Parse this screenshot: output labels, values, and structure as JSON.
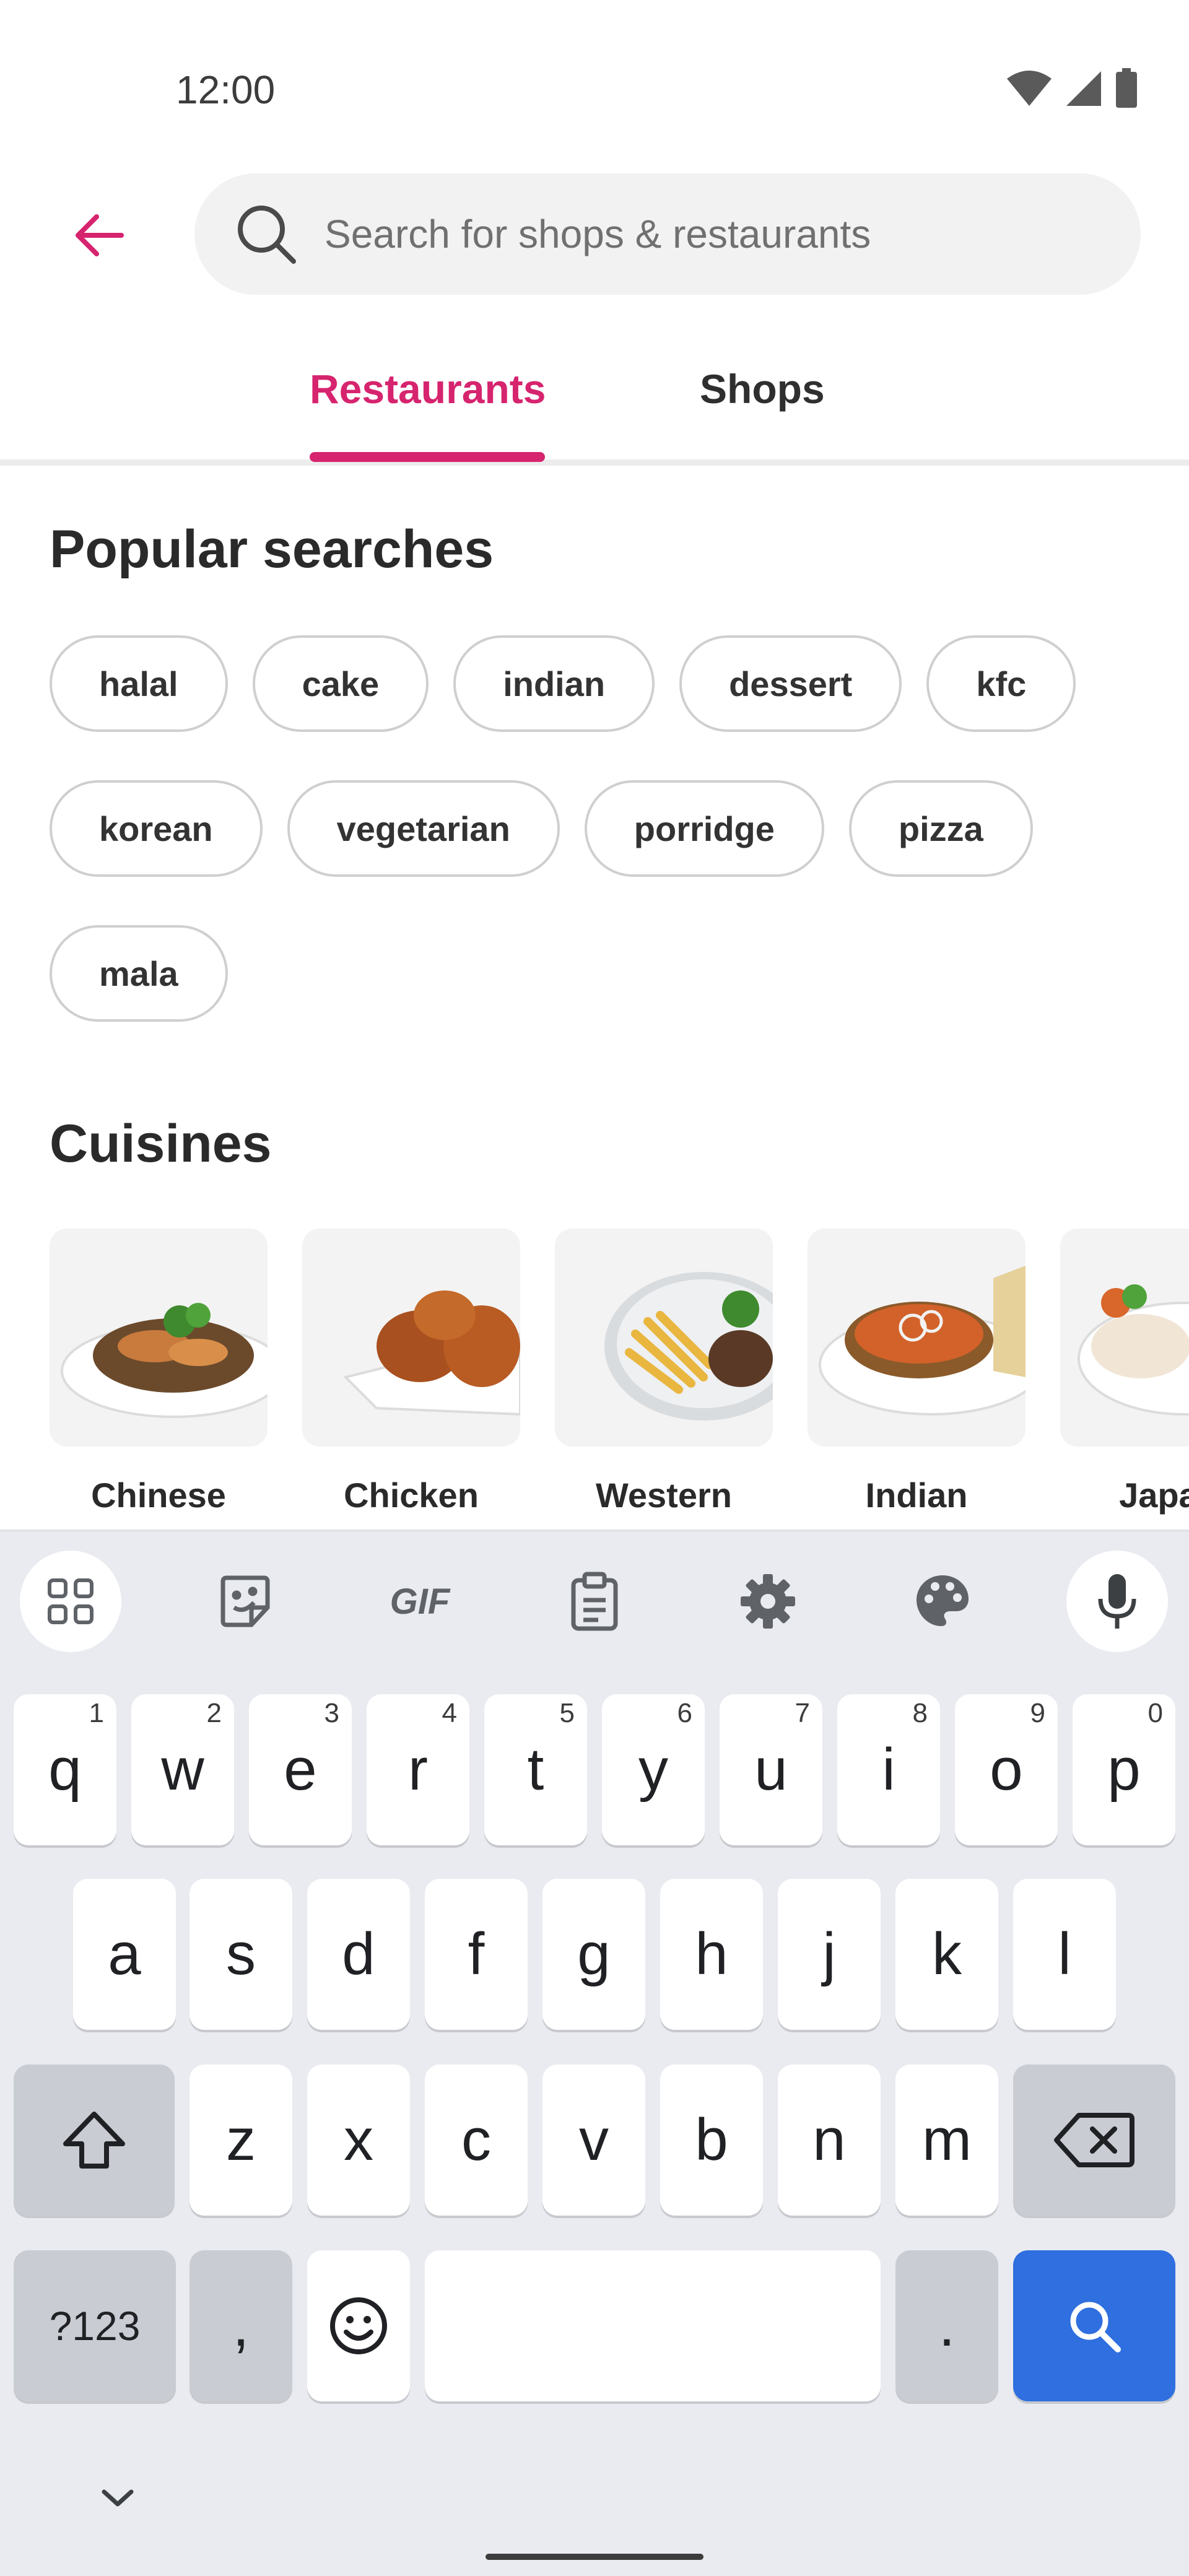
{
  "status_bar": {
    "time": "12:00"
  },
  "header": {
    "search_placeholder": "Search for shops & restaurants"
  },
  "tabs": [
    {
      "label": "Restaurants",
      "selected": true
    },
    {
      "label": "Shops",
      "selected": false
    }
  ],
  "accent_color": "#d6246e",
  "popular": {
    "title": "Popular searches",
    "rows": [
      [
        "halal",
        "cake",
        "indian",
        "dessert",
        "kfc"
      ],
      [
        "korean",
        "vegetarian",
        "porridge",
        "pizza"
      ],
      [
        "mala"
      ]
    ]
  },
  "cuisines": {
    "title": "Cuisines",
    "items": [
      {
        "label": "Chinese",
        "icon": "chinese-noodles-image"
      },
      {
        "label": "Chicken",
        "icon": "fried-chicken-image"
      },
      {
        "label": "Western",
        "icon": "steak-fries-image"
      },
      {
        "label": "Indian",
        "icon": "curry-image"
      },
      {
        "label": "Japan",
        "icon": "japanese-food-image"
      }
    ]
  },
  "keyboard": {
    "toolbar": [
      "apps-grid-icon",
      "sticker-icon",
      "gif-icon",
      "clipboard-icon",
      "settings-icon",
      "palette-icon",
      "microphone-icon"
    ],
    "gif_label": "GIF",
    "row1": [
      {
        "key": "q",
        "hint": "1"
      },
      {
        "key": "w",
        "hint": "2"
      },
      {
        "key": "e",
        "hint": "3"
      },
      {
        "key": "r",
        "hint": "4"
      },
      {
        "key": "t",
        "hint": "5"
      },
      {
        "key": "y",
        "hint": "6"
      },
      {
        "key": "u",
        "hint": "7"
      },
      {
        "key": "i",
        "hint": "8"
      },
      {
        "key": "o",
        "hint": "9"
      },
      {
        "key": "p",
        "hint": "0"
      }
    ],
    "row2": [
      "a",
      "s",
      "d",
      "f",
      "g",
      "h",
      "j",
      "k",
      "l"
    ],
    "row3": [
      "z",
      "x",
      "c",
      "v",
      "b",
      "n",
      "m"
    ],
    "symbols_label": "?123",
    "comma_label": ",",
    "period_label": ".",
    "action_color": "#2f6fdf"
  }
}
